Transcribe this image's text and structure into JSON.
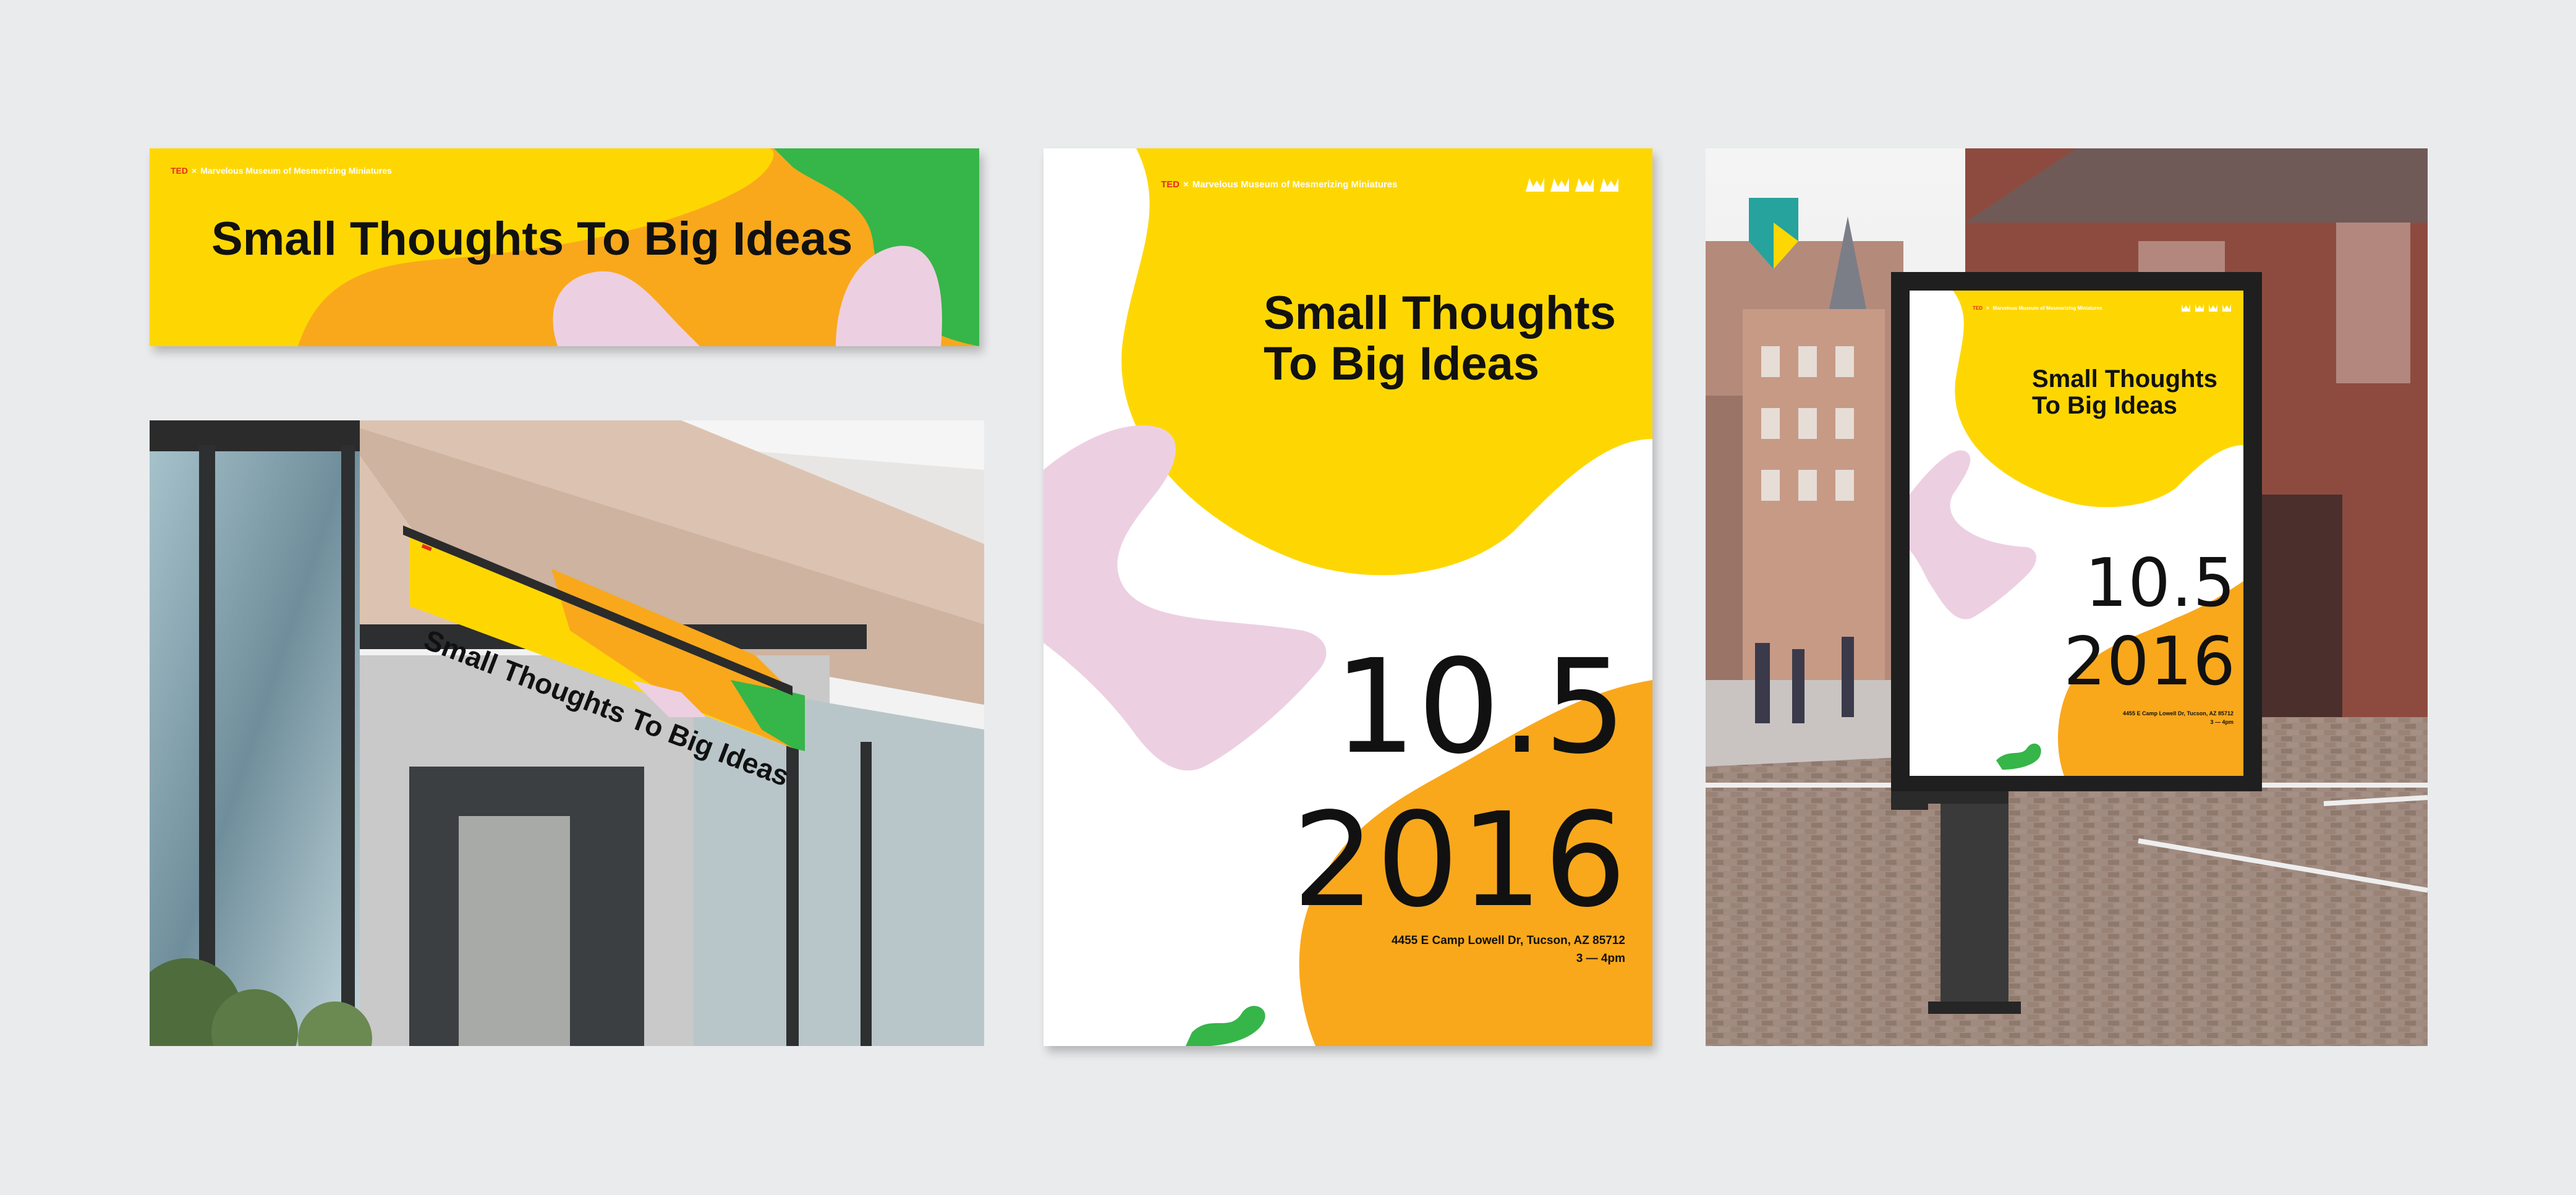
{
  "brand": {
    "ted_mark": "TED",
    "separator": "×",
    "organization": "Marvelous Museum of Mesmerizing Miniatures",
    "headline": "Small Thoughts To Big Ideas",
    "headline_line1": "Small Thoughts",
    "headline_line2": "To Big Ideas",
    "headline_sign_text": "Small Thoughts To Big Ideas",
    "date_line1": "10.5",
    "date_line2": "2016",
    "address": "4455 E Camp Lowell Dr, Tucson, AZ 85712",
    "hours": "3 — 4pm",
    "logo_icon": "crown-icons"
  },
  "colors": {
    "background": "#eaebed",
    "yellow": "#fed703",
    "orange": "#f9a81c",
    "green": "#36b549",
    "pink": "#edcfe2",
    "red": "#e62b1e",
    "text": "#111111"
  }
}
